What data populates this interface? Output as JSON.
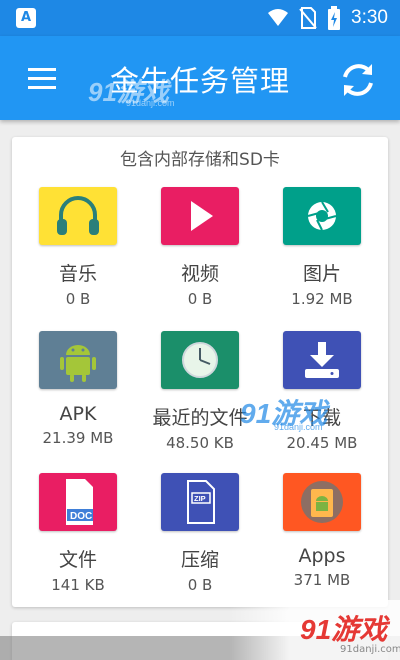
{
  "status_bar": {
    "left_icon_letter": "A",
    "time": "3:30"
  },
  "app_bar": {
    "title": "金牛任务管理"
  },
  "watermarks": {
    "logo_text": "91游戏",
    "url_text": "91danji.com"
  },
  "card": {
    "title": "包含内部存储和SD卡",
    "tiles": [
      {
        "label": "音乐",
        "size": "0 B",
        "icon": "headphones-icon",
        "color": "#ffe135"
      },
      {
        "label": "视频",
        "size": "0 B",
        "icon": "play-icon",
        "color": "#e91e63"
      },
      {
        "label": "图片",
        "size": "1.92 MB",
        "icon": "camera-aperture-icon",
        "color": "#00a08a"
      },
      {
        "label": "APK",
        "size": "21.39 MB",
        "icon": "android-icon",
        "color": "#5f7f95"
      },
      {
        "label": "最近的文件",
        "size": "48.50 KB",
        "icon": "clock-icon",
        "color": "#1b8f6a"
      },
      {
        "label": "下载",
        "size": "20.45 MB",
        "icon": "download-icon",
        "color": "#3f51b5"
      },
      {
        "label": "文件",
        "size": "141 KB",
        "icon": "doc-file-icon",
        "color": "#e91e63"
      },
      {
        "label": "压缩",
        "size": "0 B",
        "icon": "zip-file-icon",
        "color": "#3f51b5"
      },
      {
        "label": "Apps",
        "size": "371 MB",
        "icon": "apps-icon",
        "color": "#ff5722"
      }
    ]
  }
}
